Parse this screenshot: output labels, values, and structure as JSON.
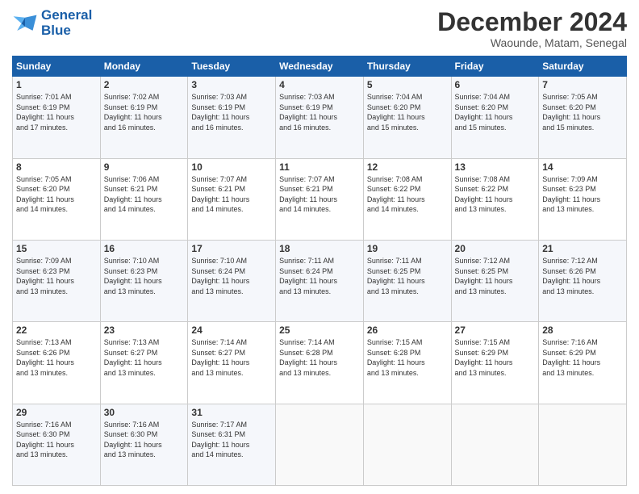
{
  "logo": {
    "line1": "General",
    "line2": "Blue"
  },
  "title": "December 2024",
  "location": "Waounde, Matam, Senegal",
  "weekdays": [
    "Sunday",
    "Monday",
    "Tuesday",
    "Wednesday",
    "Thursday",
    "Friday",
    "Saturday"
  ],
  "weeks": [
    [
      {
        "day": "1",
        "info": "Sunrise: 7:01 AM\nSunset: 6:19 PM\nDaylight: 11 hours\nand 17 minutes."
      },
      {
        "day": "2",
        "info": "Sunrise: 7:02 AM\nSunset: 6:19 PM\nDaylight: 11 hours\nand 16 minutes."
      },
      {
        "day": "3",
        "info": "Sunrise: 7:03 AM\nSunset: 6:19 PM\nDaylight: 11 hours\nand 16 minutes."
      },
      {
        "day": "4",
        "info": "Sunrise: 7:03 AM\nSunset: 6:19 PM\nDaylight: 11 hours\nand 16 minutes."
      },
      {
        "day": "5",
        "info": "Sunrise: 7:04 AM\nSunset: 6:20 PM\nDaylight: 11 hours\nand 15 minutes."
      },
      {
        "day": "6",
        "info": "Sunrise: 7:04 AM\nSunset: 6:20 PM\nDaylight: 11 hours\nand 15 minutes."
      },
      {
        "day": "7",
        "info": "Sunrise: 7:05 AM\nSunset: 6:20 PM\nDaylight: 11 hours\nand 15 minutes."
      }
    ],
    [
      {
        "day": "8",
        "info": "Sunrise: 7:05 AM\nSunset: 6:20 PM\nDaylight: 11 hours\nand 14 minutes."
      },
      {
        "day": "9",
        "info": "Sunrise: 7:06 AM\nSunset: 6:21 PM\nDaylight: 11 hours\nand 14 minutes."
      },
      {
        "day": "10",
        "info": "Sunrise: 7:07 AM\nSunset: 6:21 PM\nDaylight: 11 hours\nand 14 minutes."
      },
      {
        "day": "11",
        "info": "Sunrise: 7:07 AM\nSunset: 6:21 PM\nDaylight: 11 hours\nand 14 minutes."
      },
      {
        "day": "12",
        "info": "Sunrise: 7:08 AM\nSunset: 6:22 PM\nDaylight: 11 hours\nand 14 minutes."
      },
      {
        "day": "13",
        "info": "Sunrise: 7:08 AM\nSunset: 6:22 PM\nDaylight: 11 hours\nand 13 minutes."
      },
      {
        "day": "14",
        "info": "Sunrise: 7:09 AM\nSunset: 6:23 PM\nDaylight: 11 hours\nand 13 minutes."
      }
    ],
    [
      {
        "day": "15",
        "info": "Sunrise: 7:09 AM\nSunset: 6:23 PM\nDaylight: 11 hours\nand 13 minutes."
      },
      {
        "day": "16",
        "info": "Sunrise: 7:10 AM\nSunset: 6:23 PM\nDaylight: 11 hours\nand 13 minutes."
      },
      {
        "day": "17",
        "info": "Sunrise: 7:10 AM\nSunset: 6:24 PM\nDaylight: 11 hours\nand 13 minutes."
      },
      {
        "day": "18",
        "info": "Sunrise: 7:11 AM\nSunset: 6:24 PM\nDaylight: 11 hours\nand 13 minutes."
      },
      {
        "day": "19",
        "info": "Sunrise: 7:11 AM\nSunset: 6:25 PM\nDaylight: 11 hours\nand 13 minutes."
      },
      {
        "day": "20",
        "info": "Sunrise: 7:12 AM\nSunset: 6:25 PM\nDaylight: 11 hours\nand 13 minutes."
      },
      {
        "day": "21",
        "info": "Sunrise: 7:12 AM\nSunset: 6:26 PM\nDaylight: 11 hours\nand 13 minutes."
      }
    ],
    [
      {
        "day": "22",
        "info": "Sunrise: 7:13 AM\nSunset: 6:26 PM\nDaylight: 11 hours\nand 13 minutes."
      },
      {
        "day": "23",
        "info": "Sunrise: 7:13 AM\nSunset: 6:27 PM\nDaylight: 11 hours\nand 13 minutes."
      },
      {
        "day": "24",
        "info": "Sunrise: 7:14 AM\nSunset: 6:27 PM\nDaylight: 11 hours\nand 13 minutes."
      },
      {
        "day": "25",
        "info": "Sunrise: 7:14 AM\nSunset: 6:28 PM\nDaylight: 11 hours\nand 13 minutes."
      },
      {
        "day": "26",
        "info": "Sunrise: 7:15 AM\nSunset: 6:28 PM\nDaylight: 11 hours\nand 13 minutes."
      },
      {
        "day": "27",
        "info": "Sunrise: 7:15 AM\nSunset: 6:29 PM\nDaylight: 11 hours\nand 13 minutes."
      },
      {
        "day": "28",
        "info": "Sunrise: 7:16 AM\nSunset: 6:29 PM\nDaylight: 11 hours\nand 13 minutes."
      }
    ],
    [
      {
        "day": "29",
        "info": "Sunrise: 7:16 AM\nSunset: 6:30 PM\nDaylight: 11 hours\nand 13 minutes."
      },
      {
        "day": "30",
        "info": "Sunrise: 7:16 AM\nSunset: 6:30 PM\nDaylight: 11 hours\nand 13 minutes."
      },
      {
        "day": "31",
        "info": "Sunrise: 7:17 AM\nSunset: 6:31 PM\nDaylight: 11 hours\nand 14 minutes."
      },
      {
        "day": "",
        "info": ""
      },
      {
        "day": "",
        "info": ""
      },
      {
        "day": "",
        "info": ""
      },
      {
        "day": "",
        "info": ""
      }
    ]
  ]
}
